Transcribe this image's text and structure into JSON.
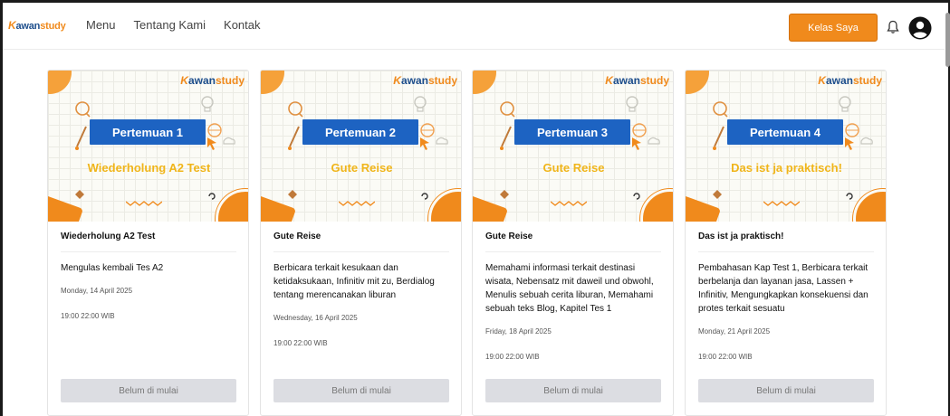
{
  "brand": {
    "k": "K",
    "awan": "awan",
    "study": "study"
  },
  "nav": {
    "links": [
      "Menu",
      "Tentang Kami",
      "Kontak"
    ]
  },
  "header": {
    "kelas_label": "Kelas Saya"
  },
  "colors": {
    "accent": "#f08a1c",
    "primary": "#1d63c2",
    "subtitle": "#f0b51a",
    "button_disabled": "#dcdde2"
  },
  "cards": [
    {
      "banner": "Pertemuan 1",
      "subtitle": "Wiederholung A2 Test",
      "title": "Wiederholung A2 Test",
      "description": "Mengulas kembali Tes A2",
      "date": "Monday, 14 April 2025",
      "time": "19:00 22:00 WIB",
      "button": "Belum di mulai"
    },
    {
      "banner": "Pertemuan 2",
      "subtitle": "Gute Reise",
      "title": "Gute Reise",
      "description": "Berbicara terkait kesukaan dan ketidaksukaan, Infinitiv mit zu, Berdialog tentang merencanakan liburan",
      "date": "Wednesday, 16 April 2025",
      "time": "19:00 22:00 WIB",
      "button": "Belum di mulai"
    },
    {
      "banner": "Pertemuan 3",
      "subtitle": "Gute Reise",
      "title": "Gute Reise",
      "description": "Memahami informasi terkait destinasi wisata, Nebensatz mit daweil und obwohl, Menulis sebuah cerita liburan, Memahami sebuah teks Blog, Kapitel Tes 1",
      "date": "Friday, 18 April 2025",
      "time": "19:00 22:00 WIB",
      "button": "Belum di mulai"
    },
    {
      "banner": "Pertemuan 4",
      "subtitle": "Das ist ja praktisch!",
      "title": "Das ist ja praktisch!",
      "description": "Pembahasan Kap Test 1, Berbicara terkait berbelanja dan layanan jasa, Lassen + Infinitiv, Mengungkapkan konsekuensi dan protes terkait sesuatu",
      "date": "Monday, 21 April 2025",
      "time": "19:00 22:00 WIB",
      "button": "Belum di mulai"
    }
  ]
}
